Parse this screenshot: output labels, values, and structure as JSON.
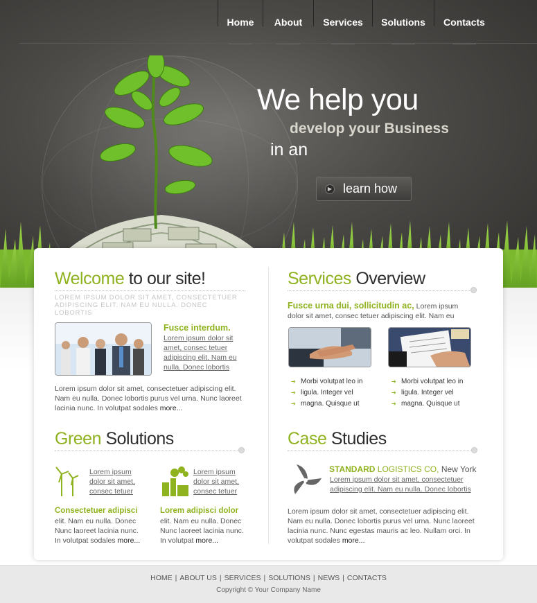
{
  "nav": {
    "items": [
      {
        "label": "Home"
      },
      {
        "label": "About"
      },
      {
        "label": "Services"
      },
      {
        "label": "Solutions"
      },
      {
        "label": "Contacts"
      }
    ]
  },
  "hero": {
    "line1": "We help you",
    "line2": "develop your Business",
    "line3": "in an",
    "button_label": "learn how"
  },
  "welcome": {
    "title_green": "Welcome",
    "title_rest": "to our site!",
    "caps_text": "LOREM IPSUM DOLOR SIT AMET, CONSECTETUER ADIPISCING ELIT. NAM EU NULLA. DONEC LOBORTIS",
    "feature_head": "Fusce interdum.",
    "feature_link": "Lorem ipsum dolor sit amet, consec tetuer adipiscing elit. Nam eu nulla. Donec lobortis",
    "body": "Lorem ipsum dolor sit amet, consectetuer adipiscing elit. Nam eu nulla. Donec lobortis purus vel urna. Nunc laoreet lacinia nunc. In volutpat sodales",
    "more": "more..."
  },
  "services": {
    "title_green": "Services",
    "title_rest": "Overview",
    "intro_green": "Fusce urna dui, sollicitudin ac,",
    "intro_rest": "Lorem ipsum dolor sit amet, consec tetuer adipiscing elit. Nam eu",
    "list_left": [
      "Morbi volutpat leo in",
      "ligula. Integer vel",
      "magna. Quisque ut"
    ],
    "list_right": [
      "Morbi volutpat leo in",
      "ligula. Integer vel",
      "magna. Quisque ut"
    ]
  },
  "green_solutions": {
    "title_green": "Green",
    "title_rest": "Solutions",
    "item1_link": "Lorem ipsum dolor sit amet, consec tetuer",
    "item2_link": "Lorem ipsum dolor sit amet, consec tetuer",
    "item1_head": "Consectetuer adipisci",
    "item1_body": "elit. Nam eu nulla. Donec Nunc laoreet lacinia nunc. In volutpat sodales",
    "item2_head": "Lorem adipisci dolor",
    "item2_body": "elit. Nam eu nulla. Donec Nunc laoreet lacinia nunc. In volutpat",
    "more": "more..."
  },
  "case_studies": {
    "title_green": "Case",
    "title_rest": "Studies",
    "company_bold": "STANDARD",
    "company_green": "LOGISTICS CO,",
    "company_city": "New York",
    "link": "Lorem ipsum dolor sit amet, consectetuer adipiscing elit. Nam eu nulla. Donec lobortis",
    "body": "Lorem ipsum dolor sit amet, consectetuer adipiscing elit. Nam eu nulla. Donec lobortis purus vel urna. Nunc laoreet lacinia nunc. Nunc egestas mauris ac leo. Nullam orci. In volutpat sodales",
    "more": "more..."
  },
  "footer": {
    "links": [
      "HOME",
      "ABOUT US",
      "SERVICES",
      "SOLUTIONS",
      "NEWS",
      "CONTACTS"
    ],
    "separator": "|",
    "copyright": "Copyright © Your Company Name"
  },
  "colors": {
    "accent": "#8fb21f",
    "header_dark": "#3d3b39",
    "footer_bg": "#e9e9e9"
  }
}
